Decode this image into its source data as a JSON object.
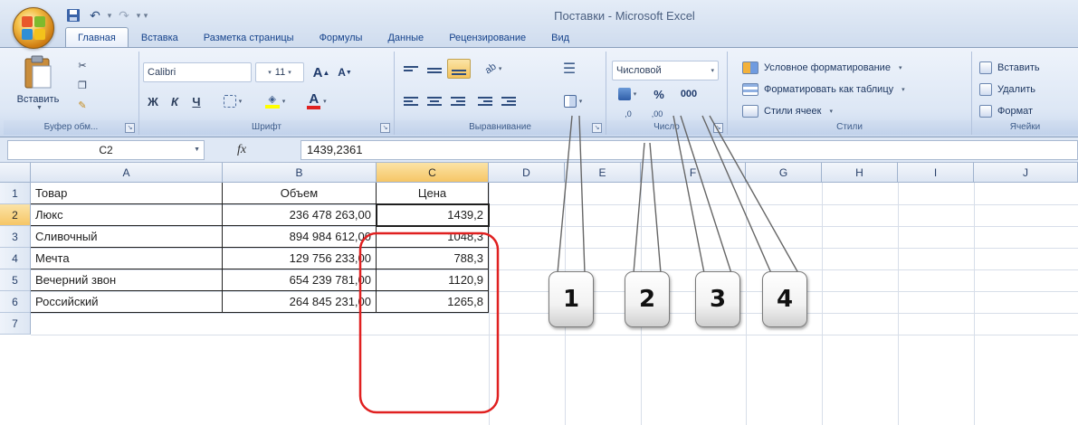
{
  "window": {
    "title": "Поставки - Microsoft Excel"
  },
  "ribbon_tabs": [
    {
      "label": "Главная",
      "active": true
    },
    {
      "label": "Вставка"
    },
    {
      "label": "Разметка страницы"
    },
    {
      "label": "Формулы"
    },
    {
      "label": "Данные"
    },
    {
      "label": "Рецензирование"
    },
    {
      "label": "Вид"
    }
  ],
  "ribbon": {
    "clipboard": {
      "paste_label": "Вставить",
      "group_label": "Буфер обм..."
    },
    "font": {
      "font_name": "Calibri",
      "font_size": "11",
      "grow_label": "A",
      "shrink_label": "A",
      "bold_label": "Ж",
      "italic_label": "К",
      "underline_label": "Ч",
      "color_label": "A",
      "group_label": "Шрифт"
    },
    "alignment": {
      "group_label": "Выравнивание"
    },
    "number": {
      "format_value": "Числовой",
      "percent_label": "%",
      "thousands_label": "000",
      "inc_decimal_label": ",0",
      "dec_decimal_label": ",00",
      "group_label": "Число"
    },
    "styles": {
      "conditional_label": "Условное форматирование",
      "format_table_label": "Форматировать как таблицу",
      "cell_styles_label": "Стили ячеек",
      "group_label": "Стили"
    },
    "cells": {
      "insert_label": "Вставить",
      "delete_label": "Удалить",
      "format_label": "Формат",
      "group_label": "Ячейки"
    }
  },
  "formula_bar": {
    "name_box": "C2",
    "fx_label": "fx",
    "formula": "1439,2361"
  },
  "sheet": {
    "columns": [
      "A",
      "B",
      "C",
      "D",
      "E",
      "F",
      "G",
      "H",
      "I",
      "J"
    ],
    "selected_column": "C",
    "rows": [
      "1",
      "2",
      "3",
      "4",
      "5",
      "6",
      "7"
    ],
    "selected_row": "2",
    "headers": {
      "a": "Товар",
      "b": "Объем",
      "c": "Цена"
    },
    "data": [
      {
        "name": "Люкс",
        "volume": "236 478 263,00",
        "price": "1439,2"
      },
      {
        "name": "Сливочный",
        "volume": "894 984 612,00",
        "price": "1048,3"
      },
      {
        "name": "Мечта",
        "volume": "129 756 233,00",
        "price": "788,3"
      },
      {
        "name": "Вечерний звон",
        "volume": "654 239 781,00",
        "price": "1120,9"
      },
      {
        "name": "Российский",
        "volume": "264 845 231,00",
        "price": "1265,8"
      }
    ]
  },
  "callouts": [
    "1",
    "2",
    "3",
    "4"
  ],
  "colors": {
    "highlight_oval": "#e02020",
    "selected_header": "#f6c666",
    "ribbon_text": "#15428b"
  }
}
